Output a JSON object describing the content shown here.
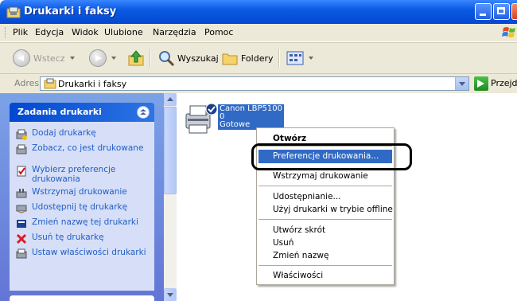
{
  "window": {
    "title": "Drukarki i faksy",
    "colors": {
      "titlebar": "#0a5ae3",
      "selection": "#316ac5",
      "task_link": "#215dc6",
      "task_pane": "#6375d6"
    }
  },
  "menubar": {
    "items": [
      "Plik",
      "Edycja",
      "Widok",
      "Ulubione",
      "Narzędzia",
      "Pomoc"
    ]
  },
  "toolbar": {
    "back_label": "Wstecz",
    "search_label": "Wyszukaj",
    "folders_label": "Foldery",
    "icons": [
      "back-icon",
      "forward-icon",
      "up-folder-icon",
      "search-icon",
      "folders-icon",
      "views-icon"
    ]
  },
  "addressbar": {
    "label": "Adres",
    "value": "Drukarki i faksy",
    "go_label": "Przejdź"
  },
  "tasks": {
    "header": "Zadania drukarki",
    "items": [
      {
        "label": "Dodaj drukarkę",
        "icon": "add-printer-icon"
      },
      {
        "label": "Zobacz, co jest drukowane",
        "icon": "print-queue-icon"
      },
      {
        "label": "Wybierz preferencje drukowania",
        "icon": "preferences-icon"
      },
      {
        "label": "Wstrzymaj drukowanie",
        "icon": "pause-icon"
      },
      {
        "label": "Udostępnij tę drukarkę",
        "icon": "share-icon"
      },
      {
        "label": "Zmień nazwę tej drukarki",
        "icon": "rename-icon"
      },
      {
        "label": "Usuń tę drukarkę",
        "icon": "delete-icon"
      },
      {
        "label": "Ustaw właściwości drukarki",
        "icon": "properties-icon"
      }
    ]
  },
  "printer": {
    "name": "Canon LBP5100",
    "docs": "0",
    "status": "Gotowe"
  },
  "context_menu": {
    "items": [
      {
        "label": "Otwórz",
        "default": true
      },
      {
        "label": "Preferencje drukowania...",
        "highlighted": true
      },
      {
        "label": "Wstrzymaj drukowanie"
      },
      {
        "label": "Udostępnianie..."
      },
      {
        "label": "Użyj drukarki w trybie offline"
      },
      {
        "label": "Utwórz skrót"
      },
      {
        "label": "Usuń"
      },
      {
        "label": "Zmień nazwę"
      },
      {
        "label": "Właściwości"
      }
    ]
  }
}
